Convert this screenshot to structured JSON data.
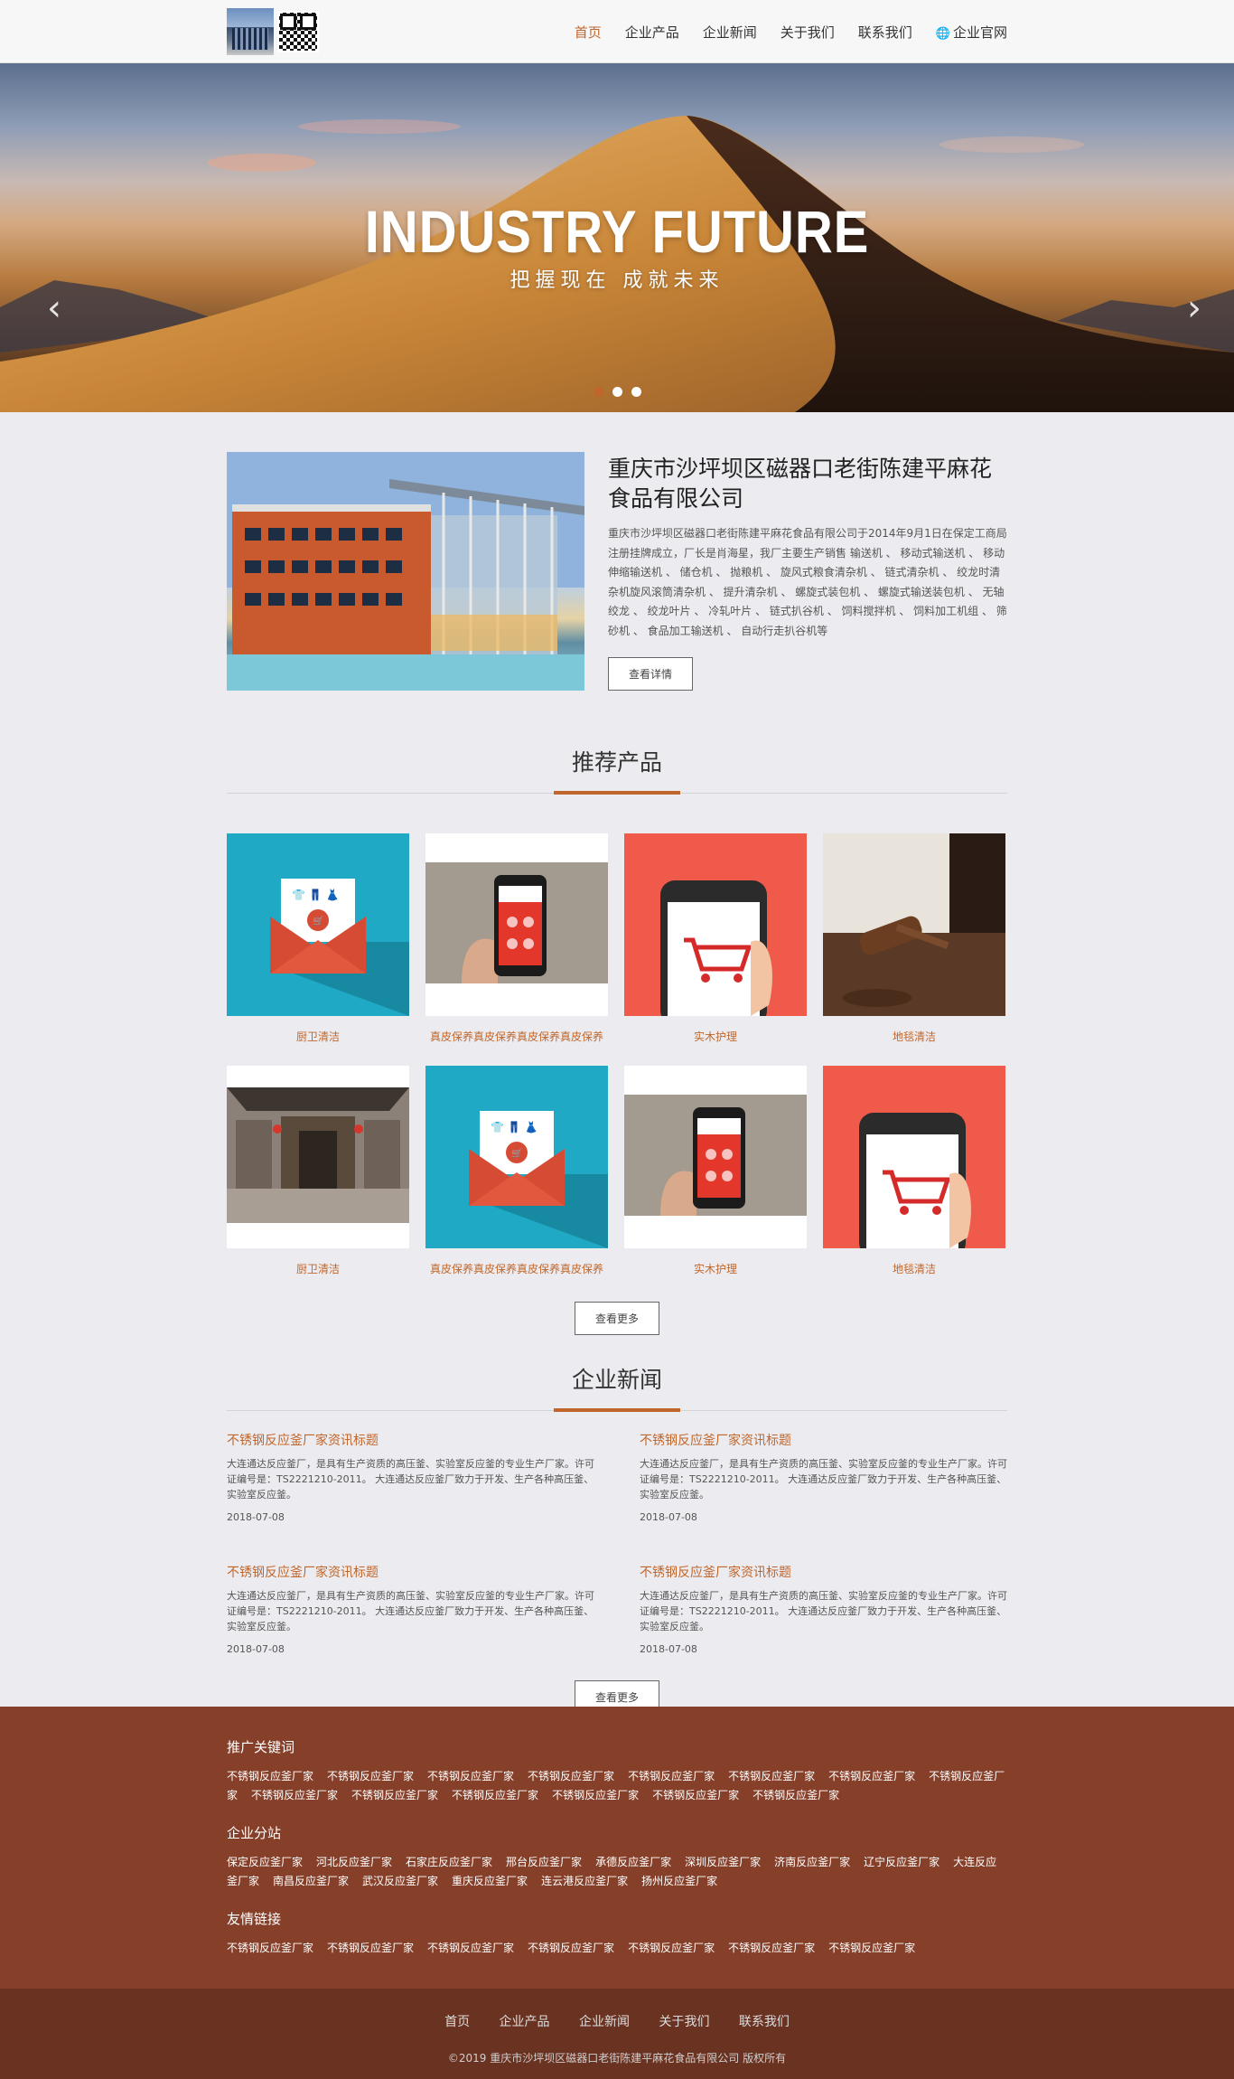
{
  "nav": {
    "items": [
      {
        "label": "首页"
      },
      {
        "label": "企业产品"
      },
      {
        "label": "企业新闻"
      },
      {
        "label": "关于我们"
      },
      {
        "label": "联系我们"
      },
      {
        "label": "企业官网"
      }
    ]
  },
  "banner": {
    "title": "INDUSTRY FUTURE",
    "subtitle": "把握现在 成就未来",
    "prev": "‹",
    "next": "›"
  },
  "about": {
    "title": "重庆市沙坪坝区磁器口老街陈建平麻花食品有限公司",
    "text": "重庆市沙坪坝区磁器口老街陈建平麻花食品有限公司于2014年9月1日在保定工商局注册挂牌成立，厂长是肖海星，我厂主要生产销售 输送机 、 移动式输送机 、 移动伸缩输送机 、 储仓机 、 抛粮机 、 旋风式粮食清杂机 、 链式清杂机 、 绞龙时清杂机旋风滚筒清杂机 、 提升清杂机 、 螺旋式装包机 、 螺旋式输送装包机 、 无轴绞龙 、 绞龙叶片 、 冷轧叶片 、 链式扒谷机 、 饲料搅拌机 、 饲料加工机组 、 筛砂机 、 食品加工输送机 、 自动行走扒谷机等",
    "button": "查看详情"
  },
  "products": {
    "heading": "推荐产品",
    "items": [
      {
        "caption": "厨卫清洁"
      },
      {
        "caption": "真皮保养真皮保养真皮保养真皮保养"
      },
      {
        "caption": "实木护理"
      },
      {
        "caption": "地毯清洁"
      },
      {
        "caption": "厨卫清洁"
      },
      {
        "caption": "真皮保养真皮保养真皮保养真皮保养"
      },
      {
        "caption": "实木护理"
      },
      {
        "caption": "地毯清洁"
      }
    ],
    "more": "查看更多"
  },
  "news": {
    "heading": "企业新闻",
    "items": [
      {
        "title": "不锈钢反应釜厂家资讯标题",
        "summary": "大连通达反应釜厂，是具有生产资质的高压釜、实验室反应釜的专业生产厂家。许可证编号是：TS2221210-2011。 大连通达反应釜厂致力于开发、生产各种高压釜、实验室反应釜。",
        "date": "2018-07-08"
      },
      {
        "title": "不锈钢反应釜厂家资讯标题",
        "summary": "大连通达反应釜厂，是具有生产资质的高压釜、实验室反应釜的专业生产厂家。许可证编号是：TS2221210-2011。 大连通达反应釜厂致力于开发、生产各种高压釜、实验室反应釜。",
        "date": "2018-07-08"
      },
      {
        "title": "不锈钢反应釜厂家资讯标题",
        "summary": "大连通达反应釜厂，是具有生产资质的高压釜、实验室反应釜的专业生产厂家。许可证编号是：TS2221210-2011。 大连通达反应釜厂致力于开发、生产各种高压釜、实验室反应釜。",
        "date": "2018-07-08"
      },
      {
        "title": "不锈钢反应釜厂家资讯标题",
        "summary": "大连通达反应釜厂，是具有生产资质的高压釜、实验室反应釜的专业生产厂家。许可证编号是：TS2221210-2011。 大连通达反应釜厂致力于开发、生产各种高压釜、实验室反应釜。",
        "date": "2018-07-08"
      }
    ],
    "more": "查看更多"
  },
  "footer": {
    "keywords_title": "推广关键词",
    "keywords": [
      "不锈钢反应釜厂家",
      "不锈钢反应釜厂家",
      "不锈钢反应釜厂家",
      "不锈钢反应釜厂家",
      "不锈钢反应釜厂家",
      "不锈钢反应釜厂家",
      "不锈钢反应釜厂家",
      "不锈钢反应釜厂家",
      "不锈钢反应釜厂家",
      "不锈钢反应釜厂家",
      "不锈钢反应釜厂家",
      "不锈钢反应釜厂家",
      "不锈钢反应釜厂家",
      "不锈钢反应釜厂家"
    ],
    "branches_title": "企业分站",
    "branches": [
      "保定反应釜厂家",
      "河北反应釜厂家",
      "石家庄反应釜厂家",
      "邢台反应釜厂家",
      "承德反应釜厂家",
      "深圳反应釜厂家",
      "济南反应釜厂家",
      "辽宁反应釜厂家",
      "大连反应釜厂家",
      "南昌反应釜厂家",
      "武汉反应釜厂家",
      "重庆反应釜厂家",
      "连云港反应釜厂家",
      "扬州反应釜厂家"
    ],
    "friends_title": "友情链接",
    "friends": [
      "不锈钢反应釜厂家",
      "不锈钢反应釜厂家",
      "不锈钢反应釜厂家",
      "不锈钢反应釜厂家",
      "不锈钢反应釜厂家",
      "不锈钢反应釜厂家",
      "不锈钢反应釜厂家"
    ],
    "nav": [
      "首页",
      "企业产品",
      "企业新闻",
      "关于我们",
      "联系我们"
    ],
    "copyright": "©2019 重庆市沙坪坝区磁器口老街陈建平麻花食品有限公司 版权所有"
  },
  "colors": {
    "accent": "#c0662b",
    "footer": "#86402a",
    "footer_bottom": "#6a3221"
  },
  "carousel": {
    "slides": 3,
    "active": 1
  }
}
